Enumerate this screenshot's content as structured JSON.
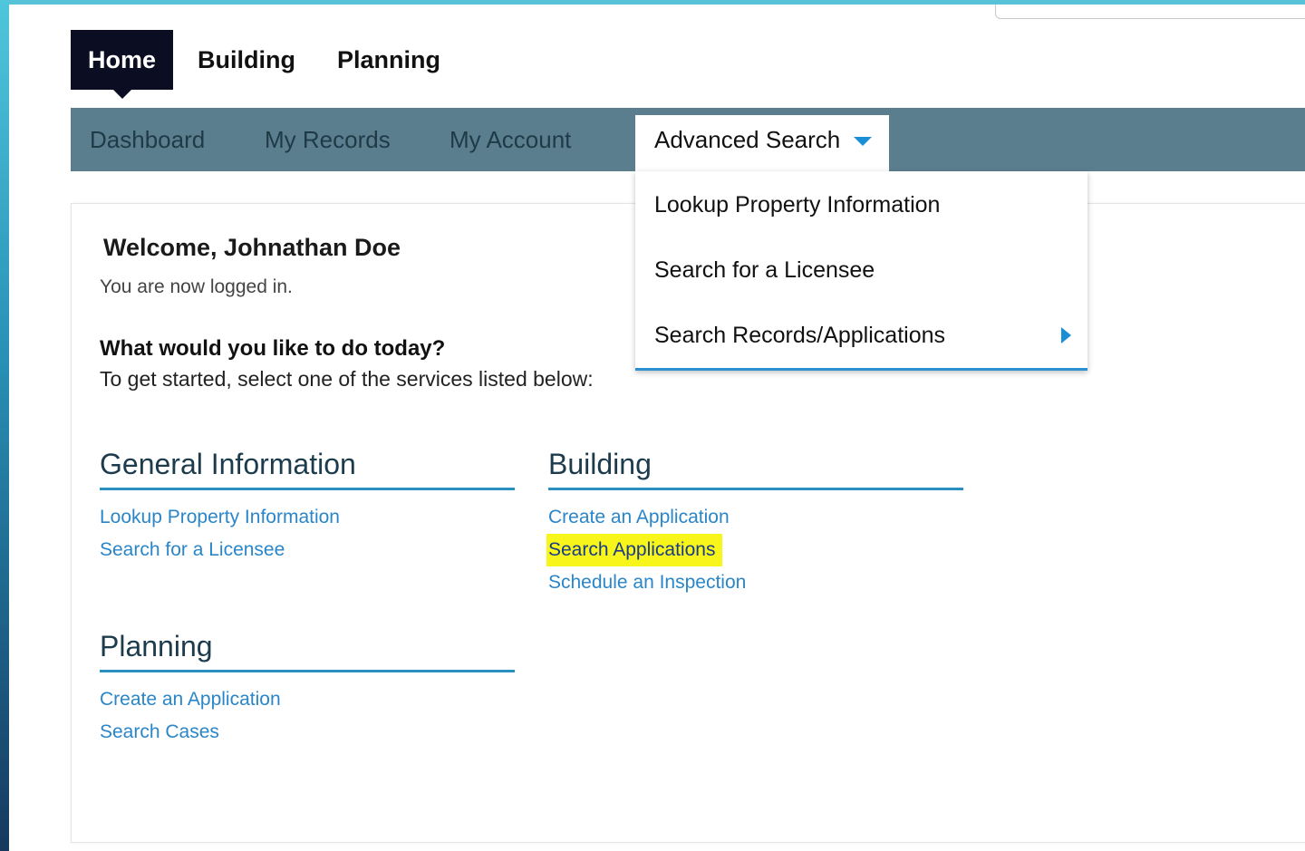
{
  "top_tabs": [
    {
      "label": "Home",
      "active": true
    },
    {
      "label": "Building",
      "active": false
    },
    {
      "label": "Planning",
      "active": false
    }
  ],
  "subnav": {
    "items": [
      "Dashboard",
      "My Records",
      "My Account"
    ],
    "active": "Advanced Search"
  },
  "dropdown": {
    "items": [
      "Lookup Property Information",
      "Search for a Licensee",
      "Search Records/Applications"
    ]
  },
  "welcome": {
    "title": "Welcome, Johnathan Doe",
    "status": "You are now logged in.",
    "question": "What would you like to do today?",
    "instructions": "To get started, select one of the services listed below:"
  },
  "sections": {
    "general": {
      "title": "General Information",
      "links": [
        "Lookup Property Information",
        "Search for a Licensee"
      ]
    },
    "building": {
      "title": "Building",
      "links": [
        "Create an Application",
        "Search Applications",
        "Schedule an Inspection"
      ]
    },
    "planning": {
      "title": "Planning",
      "links": [
        "Create an Application",
        "Search Cases"
      ]
    }
  },
  "colors": {
    "subnav_bg": "#5b7e8f",
    "active_tab_bg": "#0b0e22",
    "link": "#2a86c8",
    "section_underline": "#2b8fbf",
    "highlight": "#f7f519"
  }
}
